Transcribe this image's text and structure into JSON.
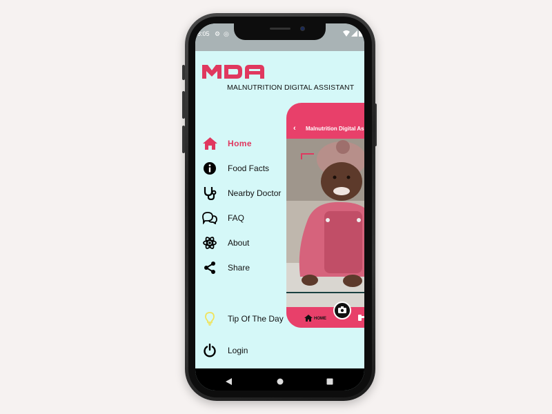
{
  "status_bar": {
    "time": "8:05"
  },
  "app": {
    "logo_text": "MDA",
    "subtitle": "MALNUTRITION DIGITAL ASSISTANT",
    "accent_color": "#e0385f",
    "background_color": "#d5f8f8"
  },
  "menu": {
    "items": [
      {
        "label": "Home",
        "icon": "home-icon",
        "active": true
      },
      {
        "label": "Food Facts",
        "icon": "info-icon",
        "active": false
      },
      {
        "label": "Nearby Doctor",
        "icon": "stethoscope-icon",
        "active": false
      },
      {
        "label": "FAQ",
        "icon": "chat-bubbles-icon",
        "active": false
      },
      {
        "label": "About",
        "icon": "atom-icon",
        "active": false
      },
      {
        "label": "Share",
        "icon": "share-icon",
        "active": false
      }
    ],
    "tip": {
      "label": "Tip Of The Day",
      "icon": "lightbulb-icon"
    },
    "login": {
      "label": "Login",
      "icon": "power-icon"
    }
  },
  "preview_card": {
    "title": "Malnutrition Digital Assistant",
    "bottom_nav_home": "HOME",
    "camera_icon": "camera-icon"
  },
  "android_nav": {
    "back": "back-icon",
    "home": "home-circle-icon",
    "recents": "recents-icon"
  }
}
